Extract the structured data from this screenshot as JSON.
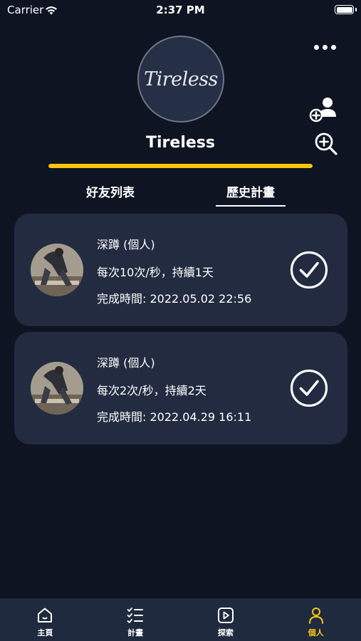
{
  "status_bar": {
    "carrier": "Carrier",
    "time": "2:37 PM"
  },
  "profile": {
    "avatar_text": "Tireless",
    "username": "Tireless",
    "progress": 1.0,
    "accent_color": "#f6c510"
  },
  "icons": {
    "more": "more-icon",
    "add_friend": "add-friend-icon",
    "search": "zoom-in-icon"
  },
  "tabs": [
    {
      "label": "好友列表",
      "active": false
    },
    {
      "label": "歷史計畫",
      "active": true
    }
  ],
  "plans": [
    {
      "title": "深蹲 (個人)",
      "detail": "每次10次/秒，持續1天",
      "completed": "完成時間: 2022.05.02 22:56"
    },
    {
      "title": "深蹲 (個人)",
      "detail": "每次2次/秒，持續2天",
      "completed": "完成時間: 2022.04.29 16:11"
    }
  ],
  "bottom_nav": [
    {
      "label": "主頁",
      "icon": "home-icon"
    },
    {
      "label": "計畫",
      "icon": "checklist-icon"
    },
    {
      "label": "探索",
      "icon": "play-icon"
    },
    {
      "label": "個人",
      "icon": "person-icon",
      "active": true
    }
  ]
}
